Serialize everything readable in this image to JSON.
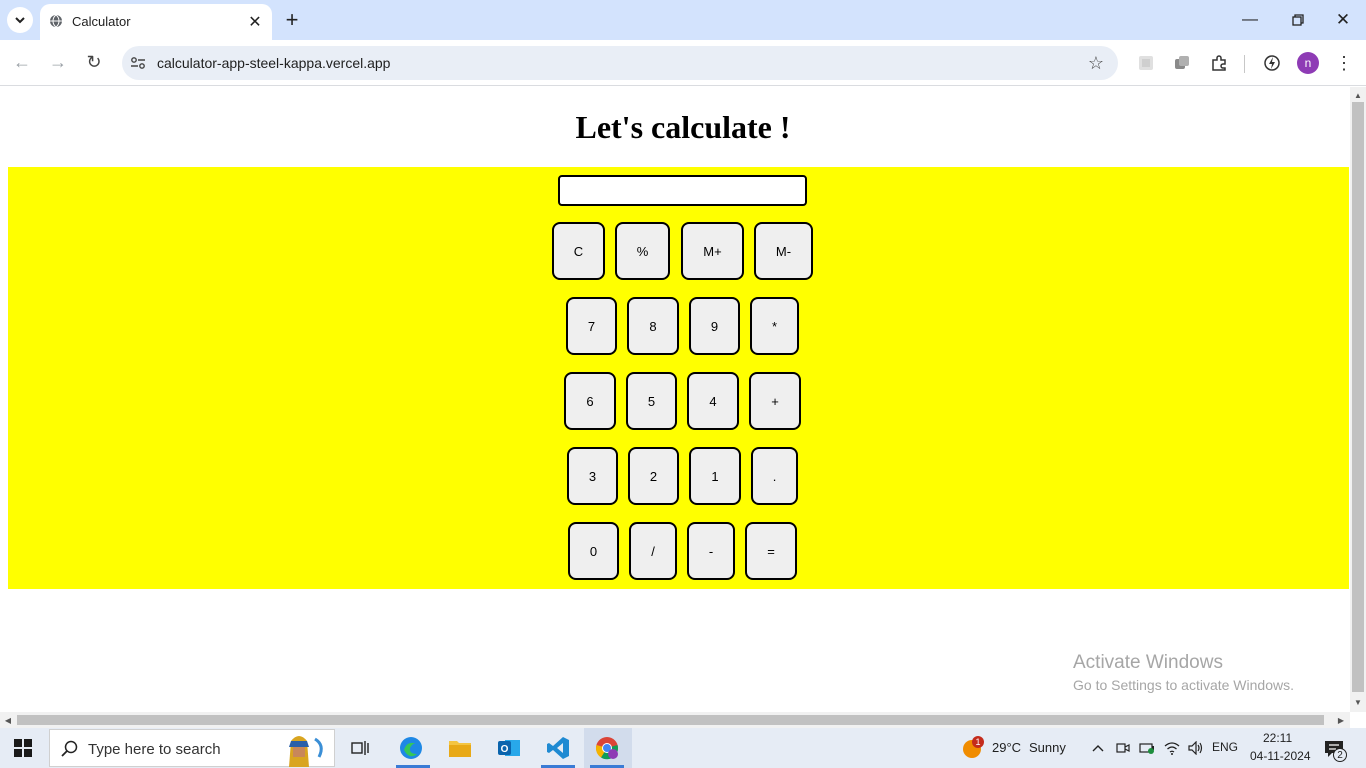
{
  "browser": {
    "tab_title": "Calculator",
    "url": "calculator-app-steel-kappa.vercel.app",
    "profile_initial": "n"
  },
  "page": {
    "heading": "Let's calculate !",
    "display_value": "",
    "keys": [
      "C",
      "%",
      "M+",
      "M-",
      "7",
      "8",
      "9",
      "*",
      "6",
      "5",
      "4",
      "+",
      "3",
      "2",
      "1",
      ".",
      "0",
      "/",
      "-",
      "="
    ],
    "panel_color": "#ffff00"
  },
  "watermark": {
    "line1": "Activate Windows",
    "line2": "Go to Settings to activate Windows."
  },
  "taskbar": {
    "search_placeholder": "Type here to search",
    "weather_temp": "29°C",
    "weather_text": "Sunny",
    "weather_badge": "1",
    "language": "ENG",
    "time": "22:11",
    "date": "04-11-2024",
    "notification_count": "2"
  }
}
